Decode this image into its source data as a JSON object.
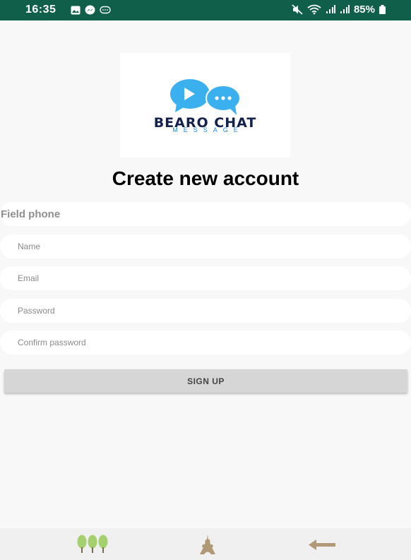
{
  "status_bar": {
    "time": "16:35",
    "battery": "85%"
  },
  "logo": {
    "title": "BEARO CHAT",
    "subtitle": "MESSAGE"
  },
  "form": {
    "title": "Create new account",
    "phone_placeholder": "Field phone",
    "name_placeholder": "Name",
    "email_placeholder": "Email",
    "password_placeholder": "Password",
    "confirm_placeholder": "Confirm password",
    "signup_label": "SIGN UP"
  },
  "bottom_nav": {
    "icons": [
      "trees-icon",
      "eiffel-tower-icon",
      "back-arrow-icon"
    ]
  },
  "colors": {
    "status_bar": "#0f5f4a",
    "logo_bubble": "#3ab0ef",
    "logo_text": "#13214b",
    "logo_sub": "#1e88e5",
    "signup_button": "#d6d6d6",
    "nav_icon_tree": "#a5d070",
    "nav_icon_brown": "#b09a75"
  }
}
